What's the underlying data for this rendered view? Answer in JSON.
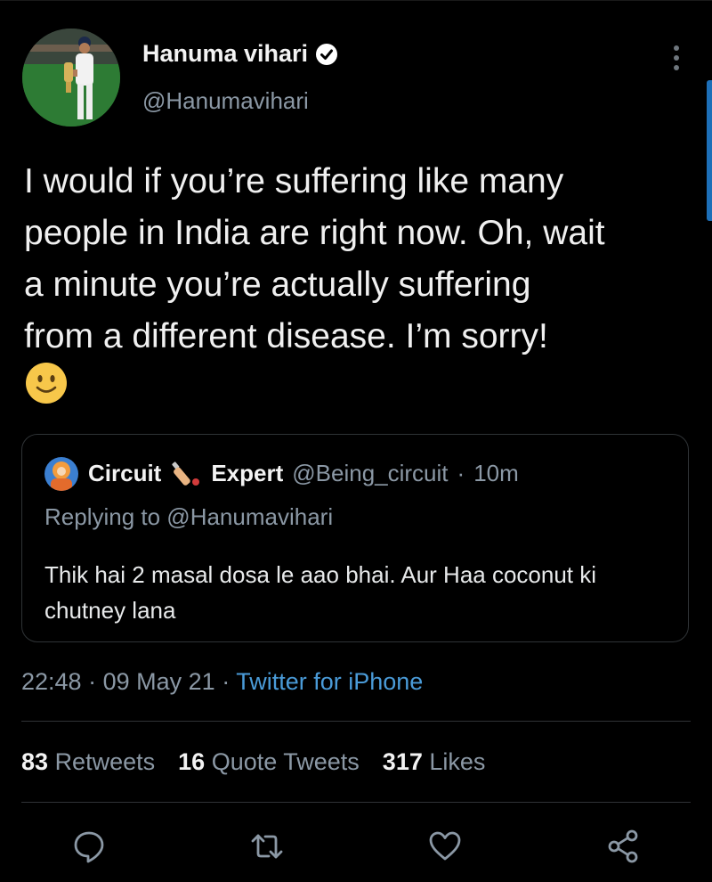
{
  "tweet": {
    "author": {
      "display_name": "Hanuma vihari",
      "handle": "@Hanumavihari",
      "verified": true
    },
    "text": "I would if you’re suffering like many\npeople in India are right now. Oh, wait\na minute you’re actually suffering\nfrom a different disease. I’m sorry!",
    "emoji_icon": "slightly-smiling-face-emoji",
    "quoted": {
      "name_part1": "Circuit",
      "name_icon": "cricket-bat-icon",
      "name_part2": "Expert",
      "handle": "@Being_circuit",
      "separator": "·",
      "time_ago": "10m",
      "replying_to": "Replying to @Hanumavihari",
      "text": "Thik hai 2 masal dosa le aao bhai. Aur Haa coconut ki chutney lana"
    },
    "time": "22:48",
    "date": "09 May 21",
    "sep": "·",
    "source": "Twitter for iPhone"
  },
  "stats": {
    "retweets_count": "83",
    "retweets_label": "Retweets",
    "quote_count": "16",
    "quote_label": "Quote Tweets",
    "likes_count": "317",
    "likes_label": "Likes"
  },
  "actions": [
    "reply-icon",
    "retweet-icon",
    "like-icon",
    "share-icon"
  ],
  "colors": {
    "background": "#000000",
    "link": "#4a9bd8",
    "muted": "#8b98a5",
    "verified": "#ffffff"
  }
}
